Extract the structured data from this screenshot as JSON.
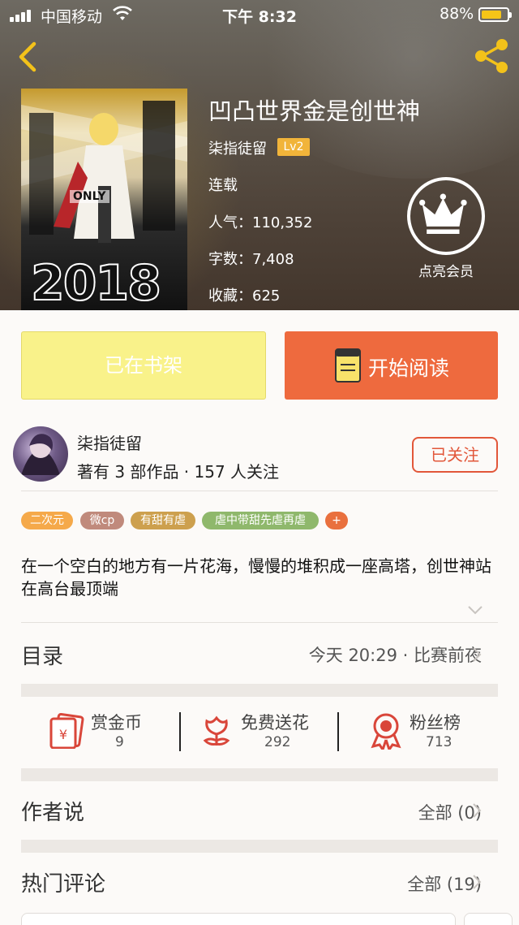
{
  "status_bar": {
    "carrier": "中国移动",
    "time": "下午 8:32",
    "battery": "88%"
  },
  "book": {
    "title": "凹凸世界金是创世神",
    "author": "柒指徒留",
    "author_level": "Lv2",
    "status": "连载",
    "popularity": "人气：110,352",
    "word_count": "字数：7,408",
    "favorites": "收藏：625",
    "cover_text": {
      "big": "2018",
      "small": "ONLY"
    }
  },
  "vip": {
    "label": "点亮会员"
  },
  "actions": {
    "shelf_label": "已在书架",
    "read_label": "开始阅读"
  },
  "author": {
    "name": "柒指徒留",
    "meta": "著有 3 部作品 · 157 人关注",
    "follow_label": "已关注"
  },
  "tags": [
    {
      "label": "二次元",
      "color": "#f5a94a"
    },
    {
      "label": "微cp",
      "color": "#c08a7c"
    },
    {
      "label": "有甜有虐",
      "color": "#cda04e"
    },
    {
      "label": "虐中带甜先虐再虐",
      "color": "#8fb86c"
    },
    {
      "label": "+",
      "color": "#e9703e"
    }
  ],
  "description": "在一个空白的地方有一片花海，慢慢的堆积成一座高塔，创世神站在高台最顶端",
  "toc": {
    "label": "目录",
    "latest": "今天 20:29 · 比赛前夜"
  },
  "rewards": [
    {
      "label": "赏金币",
      "value": "9",
      "icon": "red-envelope-icon"
    },
    {
      "label": "免费送花",
      "value": "292",
      "icon": "flower-icon"
    },
    {
      "label": "粉丝榜",
      "value": "713",
      "icon": "medal-icon"
    }
  ],
  "author_says": {
    "label": "作者说",
    "link": "全部 (0)"
  },
  "hot_comments": {
    "label": "热门评论",
    "link": "全部 (19)"
  },
  "colors": {
    "accent": "#ee6a3e",
    "shelf": "#f9f28a",
    "follow": "#e2573a",
    "icon_red": "#d9463a"
  }
}
